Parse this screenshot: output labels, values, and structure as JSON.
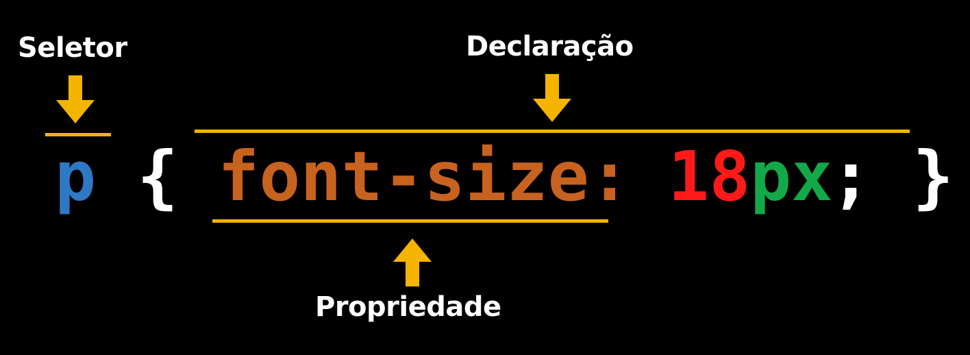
{
  "labels": {
    "selector": "Seletor",
    "declaration": "Declaração",
    "property": "Propriedade"
  },
  "code": {
    "selector": "p",
    "open_brace": "{",
    "property": "font-size:",
    "value_number": "18",
    "value_unit": "px",
    "semicolon": ";",
    "close_brace": "}"
  },
  "colors": {
    "background": "#000000",
    "label_text": "#ffffff",
    "accent_arrow_line": "#f5b400",
    "selector": "#2f78c4",
    "braces": "#ffffff",
    "property": "#c8621f",
    "value_number": "#ff1a1a",
    "value_unit": "#12a94a",
    "semicolon": "#ffffff"
  },
  "icons": {
    "selector_arrow": "arrow-down-icon",
    "declaration_arrow": "arrow-down-icon",
    "property_arrow": "arrow-up-icon"
  }
}
